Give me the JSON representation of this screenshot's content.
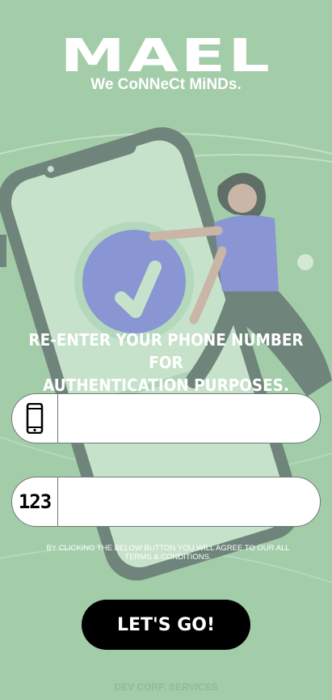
{
  "app": {
    "logo": "MAEL",
    "tagline": "We CoNNeCt MiNDs."
  },
  "main": {
    "heading_line1": "RE-ENTER YOUR PHONE NUMBER FOR",
    "heading_line2": "AUTHENTICATION PURPOSES.",
    "phone_field": {
      "value": "",
      "placeholder": "",
      "icon": "mobile-phone-icon"
    },
    "code_field": {
      "value": "",
      "placeholder": "",
      "icon_text": "123",
      "icon": "numbers-icon"
    },
    "terms_line1": "BY CLICKING THE BELOW BUTTON YOU WILL AGREE TO OUR ALL",
    "terms_line2": "TERMS & CONDITIONS.",
    "go_button": "LET'S GO!"
  },
  "footer": {
    "text": "DEV CORP. SERVICES"
  },
  "colors": {
    "background": "#a3cca9",
    "phone_frame": "#6f847a",
    "check_circle": "#8a95d4",
    "button": "#000000",
    "text": "#ffffff"
  }
}
